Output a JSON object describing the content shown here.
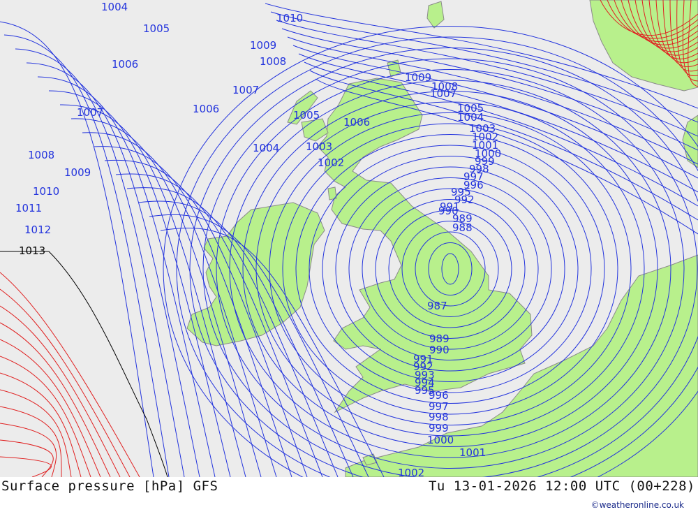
{
  "footer": {
    "title": "Surface pressure [hPa] GFS",
    "valid_time": "Tu 13-01-2026 12:00 UTC (00+228)",
    "credit": "©weatheronline.co.uk"
  },
  "colors": {
    "sea": "#ececec",
    "land": "#b8f08c",
    "isobar_blue": "#2233dd",
    "isobar_red": "#e02020",
    "isobar_black": "#000000",
    "coast": "#8a8a8a"
  },
  "isobar_labels": [
    {
      "text": "1004"
    },
    {
      "text": "1005"
    },
    {
      "text": "1010"
    },
    {
      "text": "1009"
    },
    {
      "text": "1008"
    },
    {
      "text": "1006"
    },
    {
      "text": "1007"
    },
    {
      "text": "1007"
    },
    {
      "text": "1006"
    },
    {
      "text": "1005"
    },
    {
      "text": "1006"
    },
    {
      "text": "1004"
    },
    {
      "text": "1003"
    },
    {
      "text": "1002"
    },
    {
      "text": "1008"
    },
    {
      "text": "1009"
    },
    {
      "text": "1010"
    },
    {
      "text": "1011"
    },
    {
      "text": "1012"
    },
    {
      "text": "1013"
    },
    {
      "text": "1009"
    },
    {
      "text": "1008"
    },
    {
      "text": "1007"
    },
    {
      "text": "1005"
    },
    {
      "text": "1004"
    },
    {
      "text": "1003"
    },
    {
      "text": "1002"
    },
    {
      "text": "1001"
    },
    {
      "text": "1000"
    },
    {
      "text": "999"
    },
    {
      "text": "998"
    },
    {
      "text": "997"
    },
    {
      "text": "996"
    },
    {
      "text": "995"
    },
    {
      "text": "992"
    },
    {
      "text": "991"
    },
    {
      "text": "990"
    },
    {
      "text": "989"
    },
    {
      "text": "988"
    },
    {
      "text": "987"
    },
    {
      "text": "989"
    },
    {
      "text": "990"
    },
    {
      "text": "991"
    },
    {
      "text": "992"
    },
    {
      "text": "993"
    },
    {
      "text": "994"
    },
    {
      "text": "995"
    },
    {
      "text": "996"
    },
    {
      "text": "997"
    },
    {
      "text": "998"
    },
    {
      "text": "999"
    },
    {
      "text": "1000"
    },
    {
      "text": "1001"
    },
    {
      "text": "1002"
    }
  ]
}
